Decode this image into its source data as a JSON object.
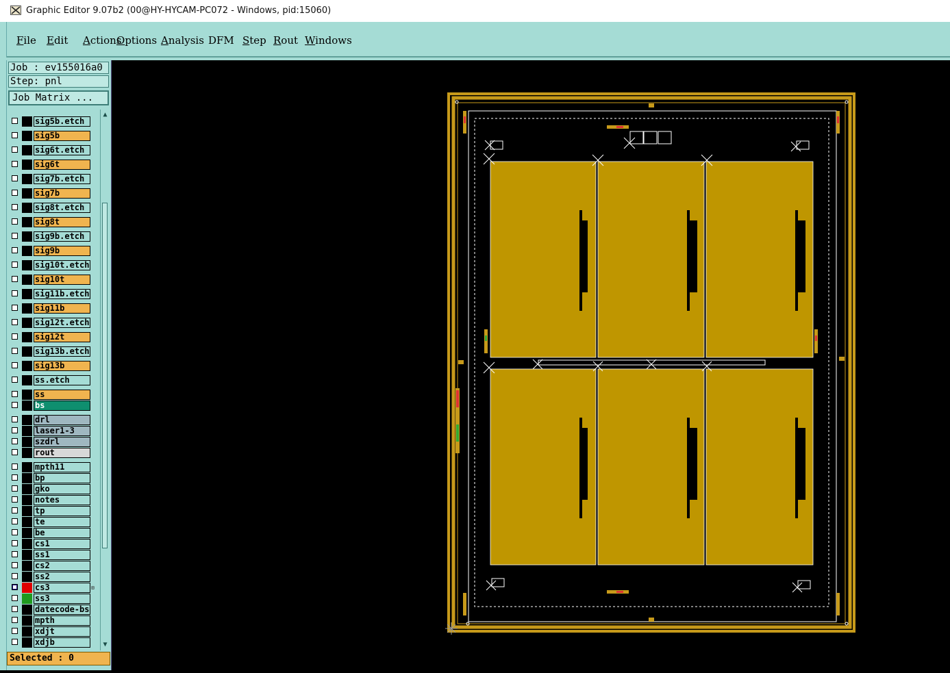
{
  "window": {
    "title": "Graphic Editor 9.07b2 (00@HY-HYCAM-PC072 - Windows, pid:15060)"
  },
  "menu": [
    {
      "label": "File",
      "u": "F",
      "rest": "ile"
    },
    {
      "label": "Edit",
      "u": "E",
      "rest": "dit"
    },
    {
      "label": "Actions",
      "u": "A",
      "rest": "ctions"
    },
    {
      "label": "Options",
      "u": "O",
      "rest": "ptions"
    },
    {
      "label": "Analysis",
      "u": "A",
      "rest": "nalysis"
    },
    {
      "label": "DFM",
      "u": "",
      "rest": "DFM"
    },
    {
      "label": "Step",
      "u": "S",
      "rest": "tep"
    },
    {
      "label": "Rout",
      "u": "R",
      "rest": "out"
    },
    {
      "label": "Windows",
      "u": "W",
      "rest": "indows"
    }
  ],
  "panel": {
    "job": "Job : ev155016a0",
    "step": "Step: pnl",
    "job_matrix": "Job Matrix ...",
    "selected": "Selected : 0"
  },
  "colors": {
    "signal": "#f0b44f",
    "etch": "#a5dcd5",
    "bs": "#0f8f6f",
    "drill": "#9fb7c0",
    "rout": "#d8d8d8",
    "board": "#bf9600",
    "frame": "#c79a1a"
  },
  "layers": [
    {
      "name": "sig5b.etch",
      "bg": "etch"
    },
    {
      "name": "sig5b",
      "bg": "signal"
    },
    {
      "name": "sig6t.etch",
      "bg": "etch"
    },
    {
      "name": "sig6t",
      "bg": "signal"
    },
    {
      "name": "sig7b.etch",
      "bg": "etch"
    },
    {
      "name": "sig7b",
      "bg": "signal"
    },
    {
      "name": "sig8t.etch",
      "bg": "etch"
    },
    {
      "name": "sig8t",
      "bg": "signal"
    },
    {
      "name": "sig9b.etch",
      "bg": "etch"
    },
    {
      "name": "sig9b",
      "bg": "signal"
    },
    {
      "name": "sig10t.etch",
      "bg": "etch"
    },
    {
      "name": "sig10t",
      "bg": "signal"
    },
    {
      "name": "sig11b.etch",
      "bg": "etch"
    },
    {
      "name": "sig11b",
      "bg": "signal"
    },
    {
      "name": "sig12t.etch",
      "bg": "etch"
    },
    {
      "name": "sig12t",
      "bg": "signal"
    },
    {
      "name": "sig13b.etch",
      "bg": "etch"
    },
    {
      "name": "sig13b",
      "bg": "signal"
    },
    {
      "name": "ss.etch",
      "bg": "etch"
    },
    {
      "name": "ss",
      "bg": "signal"
    },
    {
      "name": "bs",
      "bg": "bs"
    },
    {
      "name": "drl",
      "bg": "drill"
    },
    {
      "name": "laser1-3",
      "bg": "drill"
    },
    {
      "name": "szdrl",
      "bg": "drill"
    },
    {
      "name": "rout",
      "bg": "rout"
    },
    {
      "name": "mpth11",
      "bg": "etch"
    },
    {
      "name": "bp",
      "bg": "etch"
    },
    {
      "name": "gko",
      "bg": "etch"
    },
    {
      "name": "notes",
      "bg": "etch"
    },
    {
      "name": "tp",
      "bg": "etch"
    },
    {
      "name": "te",
      "bg": "etch"
    },
    {
      "name": "be",
      "bg": "etch"
    },
    {
      "name": "cs1",
      "bg": "etch"
    },
    {
      "name": "ss1",
      "bg": "etch"
    },
    {
      "name": "cs2",
      "bg": "etch"
    },
    {
      "name": "ss2",
      "bg": "etch"
    },
    {
      "name": "cs3",
      "bg": "etch",
      "selected": true,
      "swatch": "#e00000",
      "plus": true
    },
    {
      "name": "ss3",
      "bg": "etch",
      "swatch": "#1f9a1f"
    },
    {
      "name": "datecode-bs",
      "bg": "etch"
    },
    {
      "name": "mpth",
      "bg": "etch"
    },
    {
      "name": "xdjt",
      "bg": "etch"
    },
    {
      "name": "xdjb",
      "bg": "etch"
    }
  ],
  "icons": {
    "scroll_up": "▲",
    "scroll_down": "▼",
    "plus": "⊞"
  }
}
